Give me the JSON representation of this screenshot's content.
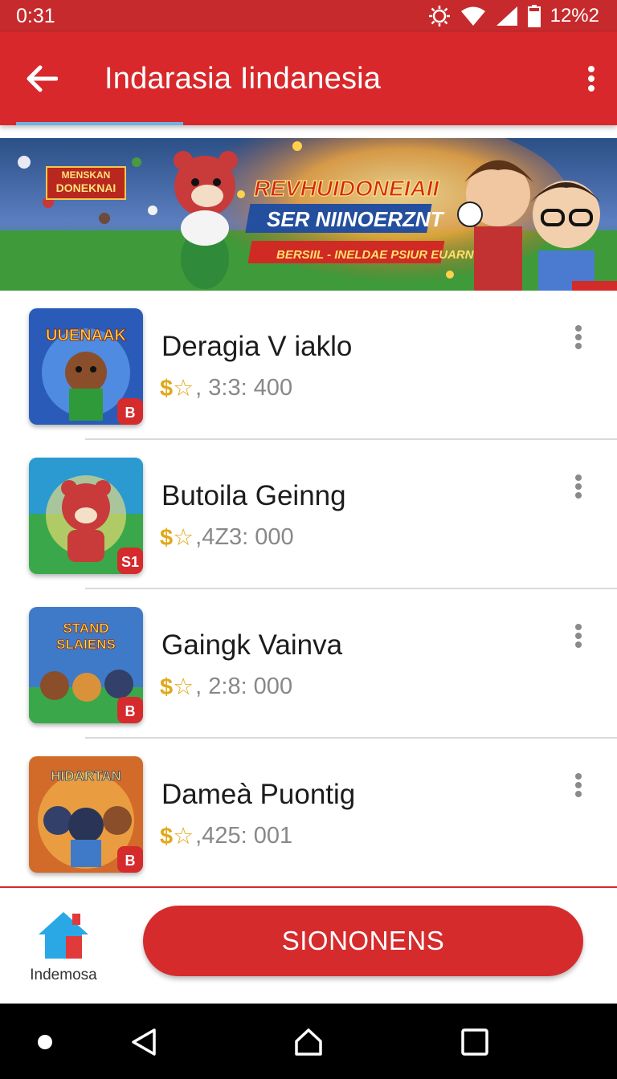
{
  "status": {
    "time": "0:31",
    "battery": "12%2"
  },
  "app_bar": {
    "title": "Indarasia Iindanesia"
  },
  "banner": {
    "badge": [
      "MENSKAN",
      "DONEKNAI"
    ],
    "headline": "REVHUIDONEIAII",
    "subheadline": "SER NIINOERZNT",
    "tagline": "BERSIIL - INELDAE PSIUR EUARN"
  },
  "items": [
    {
      "title": "Deragia V iaklo",
      "price_icon": "$☆",
      "price": ", 3:3: 400",
      "thumb_text": "UUENAAK",
      "thumb_bg": "#2a5bb8"
    },
    {
      "title": "Butoila Geinng",
      "price_icon": "$☆",
      "price": ",4Z3: 000",
      "thumb_text": "",
      "thumb_bg": "#3aa84a"
    },
    {
      "title": "Gaingk Vainva",
      "price_icon": "$☆",
      "price": ", 2:8: 000",
      "thumb_text": "STAND SLAIENS",
      "thumb_bg": "#3f7ac8"
    },
    {
      "title": "Dameà Puontig",
      "price_icon": "$☆",
      "price": ",425: 001",
      "thumb_text": "HIDARTAN",
      "thumb_bg": "#d26b2a"
    }
  ],
  "bottom": {
    "home_label": "Indemosa",
    "cta_label": "SIONONENS"
  },
  "colors": {
    "primary": "#d8282b",
    "accent_blue": "#6fb3e6",
    "price_gold": "#e0a81a"
  }
}
